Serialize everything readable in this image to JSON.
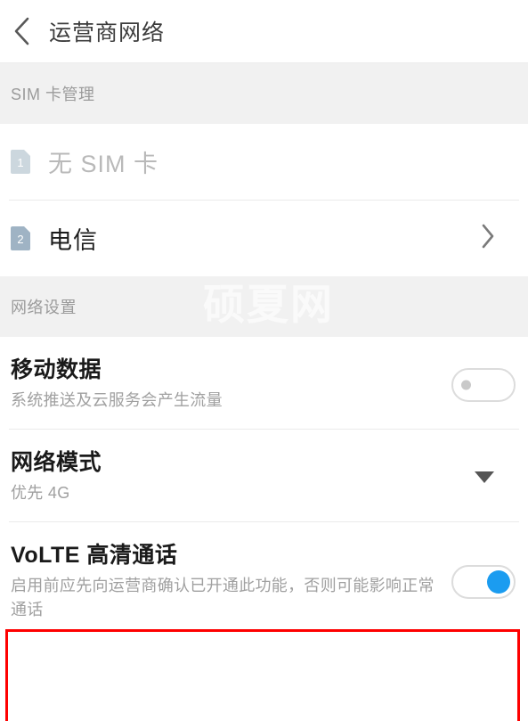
{
  "titlebar": {
    "back_icon": "chevron-left-icon",
    "title": "运营商网络"
  },
  "sections": [
    {
      "header": "SIM 卡管理",
      "watermark": "硕夏网"
    },
    {
      "header": "网络设置",
      "watermark": "硕夏网"
    }
  ],
  "sim_section": {
    "header": "SIM 卡管理",
    "rows": [
      {
        "badge": "1",
        "label": "无 SIM 卡",
        "state": "empty",
        "has_chevron": false
      },
      {
        "badge": "2",
        "label": "电信",
        "state": "active",
        "has_chevron": true,
        "chevron_icon": "chevron-right-icon"
      }
    ]
  },
  "network_section": {
    "header": "网络设置",
    "watermark": "硕夏网",
    "rows": [
      {
        "title": "移动数据",
        "subtitle": "系统推送及云服务会产生流量",
        "control": "toggle",
        "toggle_state": "off"
      },
      {
        "title": "网络模式",
        "subtitle": "优先 4G",
        "control": "caret",
        "caret_icon": "caret-down-icon"
      },
      {
        "title": "VoLTE 高清通话",
        "subtitle": "启用前应先向运营商确认已开通此功能，否则可能影响正常通话",
        "control": "toggle",
        "toggle_state": "on",
        "highlighted": true
      }
    ]
  },
  "colors": {
    "accent_blue": "#1b9cf0",
    "annotation_red": "#fe0000",
    "section_bg": "#f1f1f1",
    "sim_badge_1": "#ccd7de",
    "sim_badge_2": "#9fb3c4",
    "title_text": "#3c3c3c",
    "muted_text": "#a0a0a0"
  }
}
